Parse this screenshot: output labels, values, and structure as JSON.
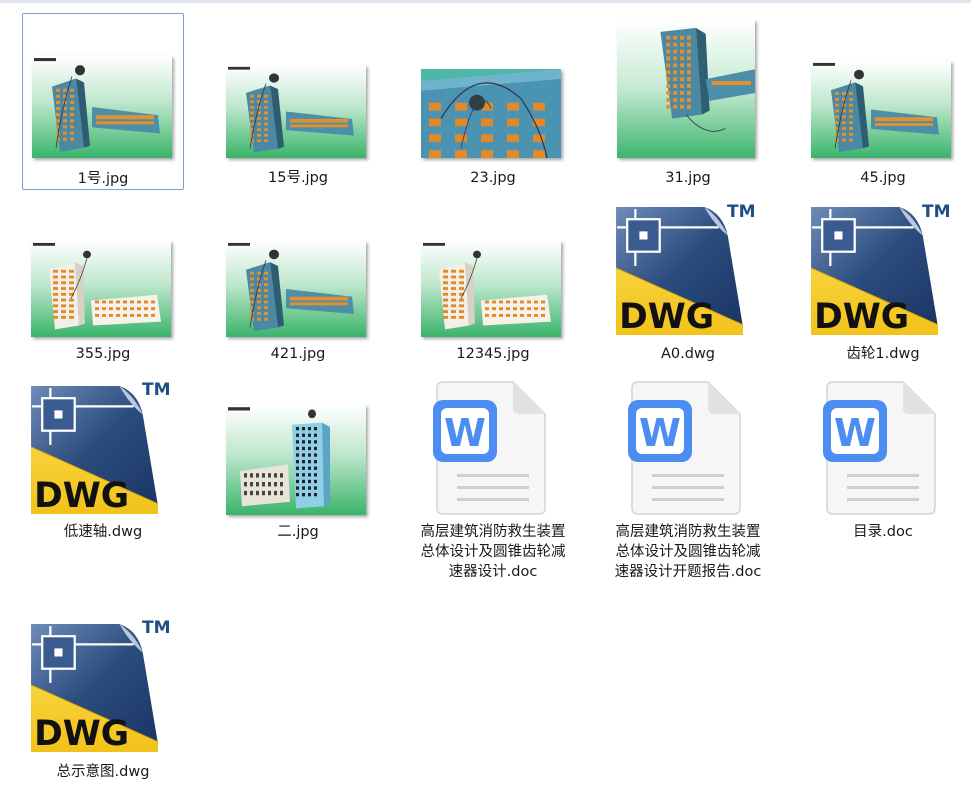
{
  "files": [
    {
      "name": "1号.jpg",
      "kind": "jpg",
      "scene": "tower-wide",
      "selected": true
    },
    {
      "name": "15号.jpg",
      "kind": "jpg",
      "scene": "tower-wide",
      "selected": false
    },
    {
      "name": "23.jpg",
      "kind": "jpg",
      "scene": "closeup",
      "selected": false
    },
    {
      "name": "31.jpg",
      "kind": "jpg",
      "scene": "tower-tall",
      "selected": false
    },
    {
      "name": "45.jpg",
      "kind": "jpg",
      "scene": "tower-wide",
      "selected": false
    },
    {
      "name": "355.jpg",
      "kind": "jpg",
      "scene": "white-building",
      "selected": false
    },
    {
      "name": "421.jpg",
      "kind": "jpg",
      "scene": "tower-wide",
      "selected": false
    },
    {
      "name": "12345.jpg",
      "kind": "jpg",
      "scene": "white-building",
      "selected": false
    },
    {
      "name": "A0.dwg",
      "kind": "dwg",
      "selected": false
    },
    {
      "name": "齿轮1.dwg",
      "kind": "dwg",
      "selected": false
    },
    {
      "name": "低速轴.dwg",
      "kind": "dwg",
      "selected": false
    },
    {
      "name": "二.jpg",
      "kind": "jpg",
      "scene": "grid-building",
      "selected": false
    },
    {
      "name": "高层建筑消防救生装置总体设计及圆锥齿轮减速器设计.doc",
      "kind": "doc",
      "selected": false
    },
    {
      "name": "高层建筑消防救生装置总体设计及圆锥齿轮减速器设计开题报告.doc",
      "kind": "doc",
      "selected": false
    },
    {
      "name": "目录.doc",
      "kind": "doc",
      "selected": false
    },
    {
      "name": "总示意图.dwg",
      "kind": "dwg",
      "selected": false
    }
  ],
  "icons": {
    "dwg_text": "DWG",
    "dwg_tm": "TM",
    "doc_letter": "W"
  },
  "colors": {
    "dwg_yellow": "#f2c21b",
    "dwg_blue": "#2b4c7e",
    "doc_blue": "#4b8df0",
    "selection_border": "#7da2ce"
  }
}
